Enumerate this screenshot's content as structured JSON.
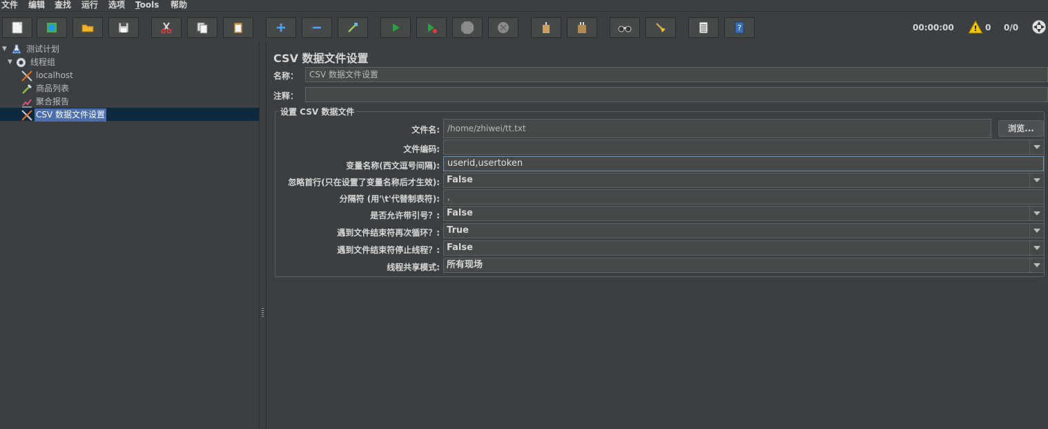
{
  "menu": [
    "文件",
    "编辑",
    "查找",
    "运行",
    "选项",
    "Tools",
    "帮助"
  ],
  "status": {
    "timer": "00:00:00",
    "warnings": "0",
    "threads": "0/0"
  },
  "tree": {
    "items": [
      {
        "label": "测试计划",
        "icon": "flask-icon"
      },
      {
        "label": "线程组",
        "icon": "gear-icon"
      },
      {
        "label": "localhost",
        "icon": "wrench-icon"
      },
      {
        "label": "商品列表",
        "icon": "pipette-icon"
      },
      {
        "label": "聚合报告",
        "icon": "chart-icon"
      },
      {
        "label": "CSV 数据文件设置",
        "icon": "wrench-icon"
      }
    ]
  },
  "panel": {
    "title": "CSV 数据文件设置",
    "name_label": "名称：",
    "name_value": "CSV 数据文件设置",
    "comment_label": "注释：",
    "comment_value": "",
    "group_title": "设置 CSV 数据文件",
    "browse_label": "浏览...",
    "rows": [
      {
        "label": "文件名:",
        "value": "/home/zhiwei/tt.txt",
        "kind": "text"
      },
      {
        "label": "文件编码:",
        "value": "",
        "kind": "combo"
      },
      {
        "label": "变量名称(西文逗号间隔):",
        "value": "userid,usertoken",
        "kind": "focus"
      },
      {
        "label": "忽略首行(只在设置了变量名称后才生效):",
        "value": "False",
        "kind": "combo"
      },
      {
        "label": "分隔符 (用'\\t'代替制表符):",
        "value": ",",
        "kind": "text"
      },
      {
        "label": "是否允许带引号？:",
        "value": "False",
        "kind": "combo"
      },
      {
        "label": "遇到文件结束符再次循环？:",
        "value": "True",
        "kind": "combo"
      },
      {
        "label": "遇到文件结束符停止线程？:",
        "value": "False",
        "kind": "combo"
      },
      {
        "label": "线程共享模式:",
        "value": "所有现场",
        "kind": "combo"
      }
    ]
  },
  "colors": {
    "background": "#3c3f41",
    "selection": "#4b6eaf",
    "focus_border": "#6897bb"
  }
}
